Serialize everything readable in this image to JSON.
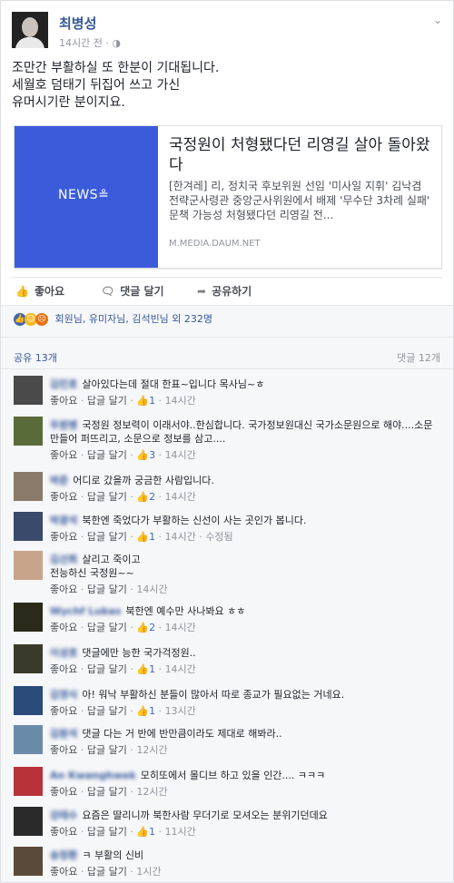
{
  "post": {
    "author": "최병성",
    "time": "14시간 전",
    "privacy_icon": "globe-icon",
    "lines": [
      "조만간 부활하실 또 한분이 기대됩니다.",
      "세월호 덤태기 뒤집어 쓰고 가신",
      "유머시기란 분이지요."
    ]
  },
  "link": {
    "thumb_text": "NEWS",
    "title": "국정원이 처형됐다던 리영길 살아 돌아왔다",
    "desc": "[한겨레] 리, 정치국 후보위원 선임 '미사일 지휘' 김낙겸 전략군사령관 중앙군사위원에서 배제 '무수단 3차례 실패' 문책 가능성 처형됐다던 리영길 전...",
    "domain": "M.MEDIA.DAUM.NET"
  },
  "actions": {
    "like": "좋아요",
    "comment": "댓글 달기",
    "share": "공유하기"
  },
  "reactions": {
    "text": "회원님, 유미자님, 김석빈님 외 232명",
    "colors": [
      "#4267b2",
      "#f7b928",
      "#e9710f"
    ]
  },
  "shares": "공유 13개",
  "comments_count": "댓글 12개",
  "comment_actions": {
    "like": "좋아요",
    "reply": "답글 달기"
  },
  "comments": [
    {
      "name": "김민호",
      "lines": [
        "살아있다는데 절대 한표~입니다 목사님~ㅎ"
      ],
      "likes": "1",
      "time": "14시간",
      "extra": "",
      "avatar": "#4a4a4a"
    },
    {
      "name": "우원병",
      "lines": [
        "국정원 정보력이 이래서야..한심합니다. 국가정보원대신 국가소문원으로 해야....소문 만들어 퍼뜨리고, 소문으로 정보를 삼고...."
      ],
      "likes": "3",
      "time": "14시간",
      "extra": "",
      "avatar": "#5a6b3a"
    },
    {
      "name": "박준",
      "lines": [
        "어디로 갔을까 궁금한 사람입니다."
      ],
      "likes": "2",
      "time": "14시간",
      "extra": "",
      "avatar": "#8a7a6a"
    },
    {
      "name": "박광석",
      "lines": [
        "북한엔 죽었다가 부활하는 신선이 사는 곳인가 봅니다."
      ],
      "likes": "1",
      "time": "14시간",
      "extra": "수정됨",
      "avatar": "#3a4a6a"
    },
    {
      "name": "김선희",
      "lines": [
        "살리고 죽이고",
        "전능하신 국정원~~"
      ],
      "likes": "",
      "time": "14시간",
      "extra": "",
      "avatar": "#c8a58a"
    },
    {
      "name": "Wychf Lukas",
      "lines": [
        "북한엔 예수만 사나봐요 ㅎㅎ"
      ],
      "likes": "2",
      "time": "14시간",
      "extra": "",
      "avatar": "#2a2a1a"
    },
    {
      "name": "이성호",
      "lines": [
        "댓글에만 능한 국가걱정원.."
      ],
      "likes": "1",
      "time": "14시간",
      "extra": "",
      "avatar": "#3a3a2a"
    },
    {
      "name": "김영식",
      "lines": [
        "아! 워낙 부활하신 분들이 많아서 따로 종교가 필요없는 거네요."
      ],
      "likes": "1",
      "time": "13시간",
      "extra": "",
      "avatar": "#2a4a7a"
    },
    {
      "name": "김원석",
      "lines": [
        "댓글 다는 거 반에 반만큼이라도 제대로 해봐라.."
      ],
      "likes": "",
      "time": "12시간",
      "extra": "",
      "avatar": "#6a8aaa"
    },
    {
      "name": "An Kwanghwek",
      "lines": [
        "모히또에서 몰디브 하고 있을 인간.... ㅋㅋㅋ"
      ],
      "likes": "",
      "time": "12시간",
      "extra": "",
      "avatar": "#b8323a"
    },
    {
      "name": "강태수",
      "lines": [
        "요즘은 딸리니까 북한사람 무더기로 모셔오는 분위기던데요"
      ],
      "likes": "1",
      "time": "11시간",
      "extra": "",
      "avatar": "#2a2a2a"
    },
    {
      "name": "송창환",
      "lines": [
        "ㅋ 부활의 신비"
      ],
      "likes": "",
      "time": "1시간",
      "extra": "",
      "avatar": "#5a4a3a"
    }
  ]
}
